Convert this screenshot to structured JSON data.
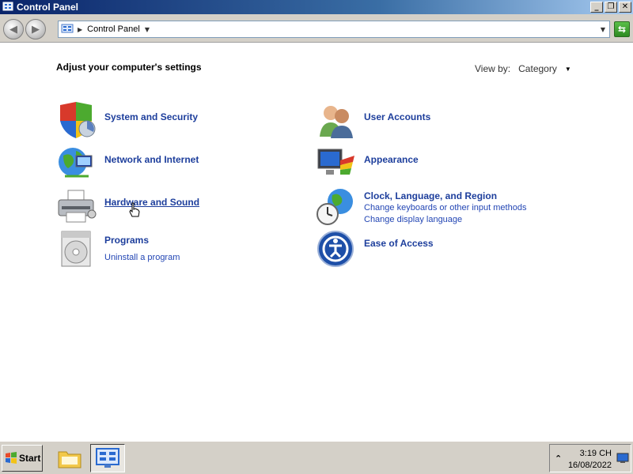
{
  "window": {
    "title": "Control Panel",
    "buttons": [
      "_",
      "❐",
      "✕"
    ]
  },
  "address_bar": {
    "crumb": "Control Panel"
  },
  "content": {
    "heading": "Adjust your computer's settings",
    "view_by": {
      "label": "View by:",
      "value": "Category"
    },
    "categories": [
      {
        "title": "System and Security",
        "icon": "shield-icon",
        "links": []
      },
      {
        "title": "Network and Internet",
        "icon": "network-globe-icon",
        "links": []
      },
      {
        "title": "Hardware and Sound",
        "icon": "printer-icon",
        "links": []
      },
      {
        "title": "Programs",
        "icon": "programs-disc-icon",
        "links": [
          "Uninstall a program"
        ]
      },
      {
        "title": "User Accounts",
        "icon": "users-icon",
        "links": []
      },
      {
        "title": "Appearance",
        "icon": "appearance-monitor-icon",
        "links": []
      },
      {
        "title": "Clock, Language, and Region",
        "icon": "clock-globe-icon",
        "links": [
          "Change keyboards or other input methods",
          "Change display language"
        ]
      },
      {
        "title": "Ease of Access",
        "icon": "ease-of-access-icon",
        "links": []
      }
    ]
  },
  "taskbar": {
    "start_label": "Start",
    "clock": {
      "time": "3:19 CH",
      "date": "16/08/2022"
    }
  }
}
